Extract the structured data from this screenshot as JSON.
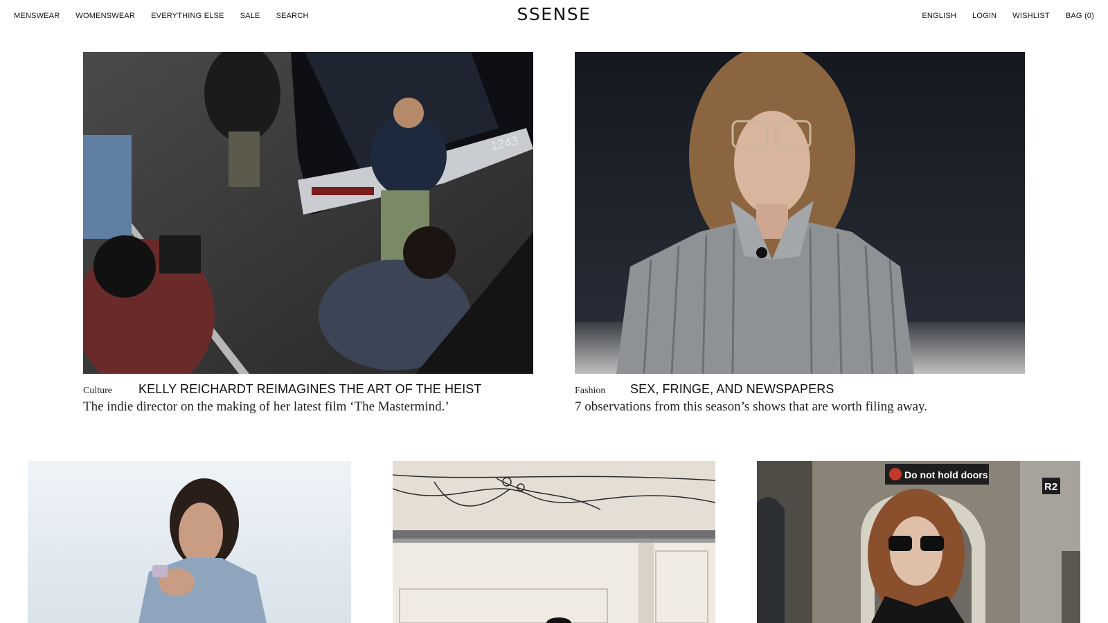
{
  "header": {
    "nav_left": [
      "MENSWEAR",
      "WOMENSWEAR",
      "EVERYTHING ELSE",
      "SALE",
      "SEARCH"
    ],
    "logo": "SSENSE",
    "nav_right": [
      "ENGLISH",
      "LOGIN",
      "WISHLIST",
      "BAG (0)"
    ]
  },
  "articles": [
    {
      "category": "Culture",
      "headline": "KELLY REICHARDT REIMAGINES THE ART OF THE HEIST",
      "dek": "The indie director on the making of her latest film ‘The Mastermind.’"
    },
    {
      "category": "Fashion",
      "headline": "SEX, FRINGE, AND NEWSPAPERS",
      "dek": "7 observations from this season’s shows that are worth filing away."
    }
  ],
  "photo_text": {
    "car_plate": "1243",
    "subway_sign": "Do not hold doors",
    "subway_car": "R2"
  },
  "colors": {
    "background": "#ffffff",
    "text": "#111111"
  }
}
